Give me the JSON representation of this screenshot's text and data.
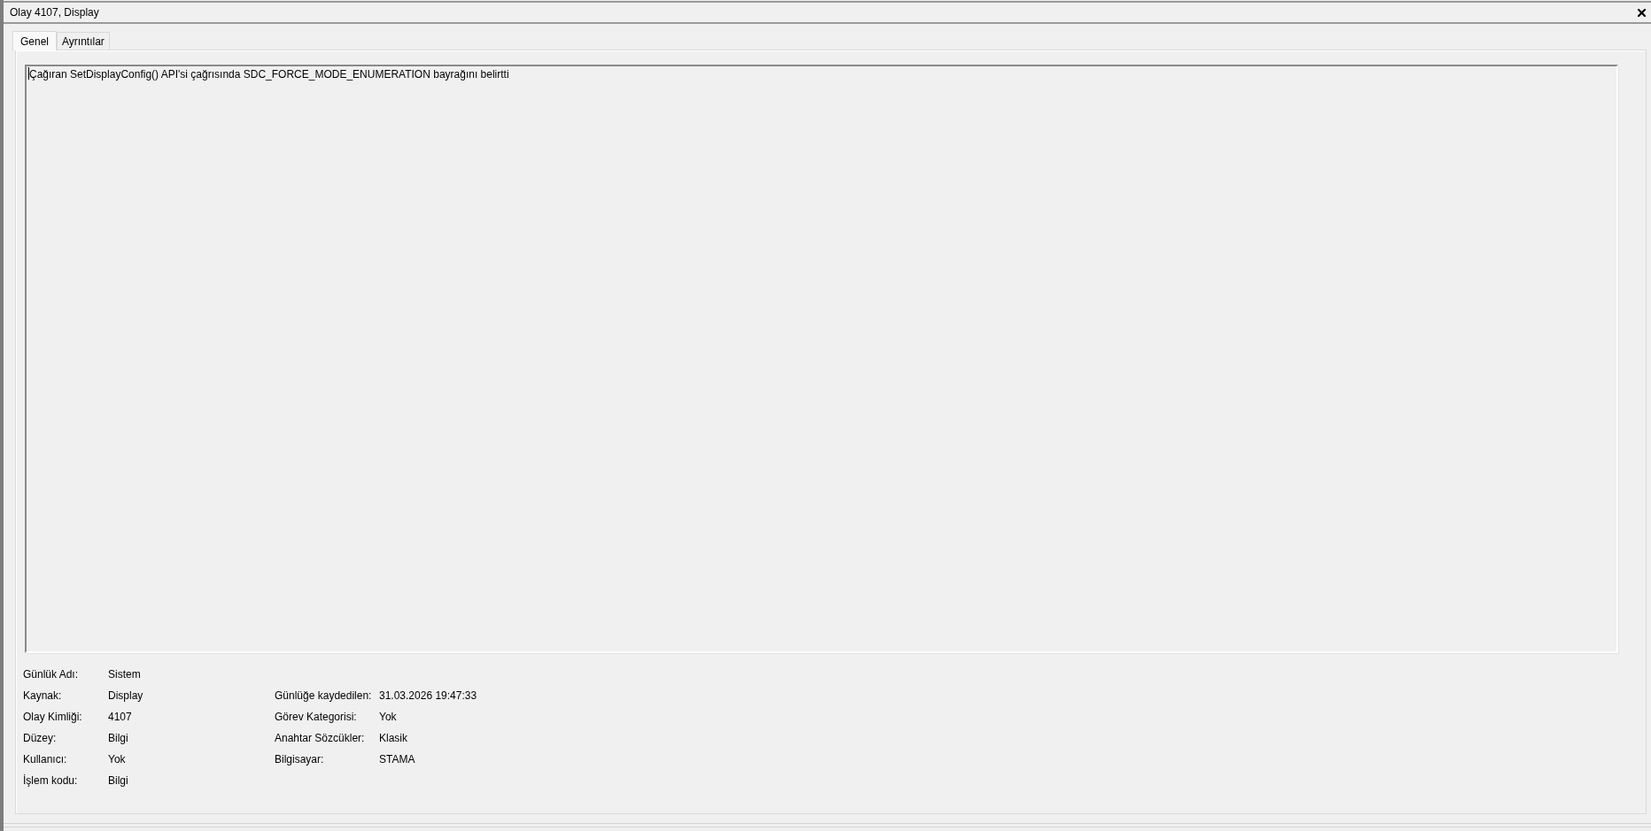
{
  "window": {
    "title": "Olay 4107, Display"
  },
  "tabs": [
    {
      "label": "Genel",
      "selected": true
    },
    {
      "label": "Ayrıntılar",
      "selected": false
    }
  ],
  "description": {
    "text": "Çağıran SetDisplayConfig() API'si çağrısında SDC_FORCE_MODE_ENUMERATION bayrağını belirtti"
  },
  "details": [
    {
      "left": {
        "label": "Günlük Adı:",
        "value": "Sistem"
      }
    },
    {
      "left": {
        "label": "Kaynak:",
        "value": "Display"
      },
      "right": {
        "label": "Günlüğe kaydedilen:",
        "value": "31.03.2026 19:47:33"
      }
    },
    {
      "left": {
        "label": "Olay Kimliği:",
        "value": "4107"
      },
      "right": {
        "label": "Görev Kategorisi:",
        "value": "Yok"
      }
    },
    {
      "left": {
        "label": "Düzey:",
        "value": "Bilgi"
      },
      "right": {
        "label": "Anahtar Sözcükler:",
        "value": "Klasik"
      }
    },
    {
      "left": {
        "label": "Kullanıcı:",
        "value": "Yok"
      },
      "right": {
        "label": "Bilgisayar:",
        "value": "STAMA"
      }
    },
    {
      "left": {
        "label": "İşlem kodu:",
        "value": "Bilgi"
      }
    }
  ]
}
